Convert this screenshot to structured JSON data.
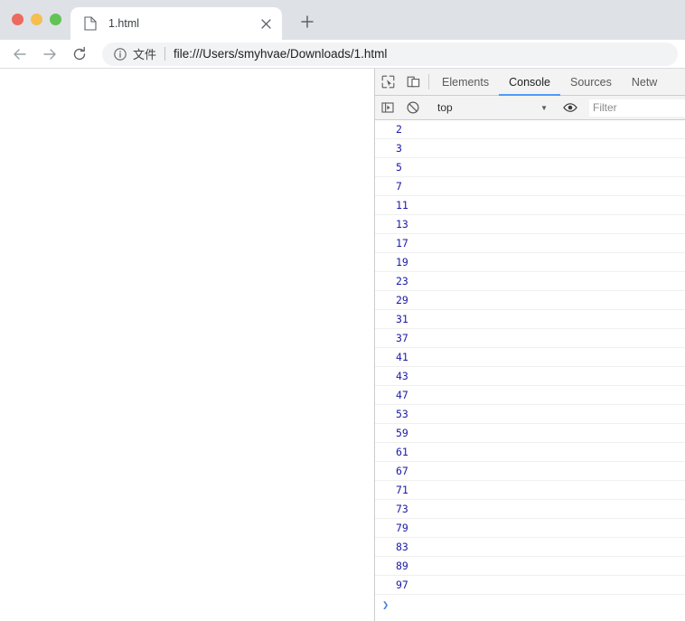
{
  "browser": {
    "window_controls": [
      {
        "name": "close",
        "color": "#ed6a5e"
      },
      {
        "name": "minimize",
        "color": "#f4bf4f"
      },
      {
        "name": "maximize",
        "color": "#61c454"
      }
    ],
    "tab": {
      "title": "1.html",
      "favicon": "document-icon",
      "close_label": "×"
    },
    "new_tab_label": "+",
    "nav": {
      "back_label": "←",
      "forward_label": "→",
      "reload_label": "↻"
    },
    "omnibox": {
      "info_icon": "info-circle-icon",
      "scheme_label": "文件",
      "url": "file:///Users/smyhvae/Downloads/1.html"
    }
  },
  "devtools": {
    "inspect_icon": "inspect-element-icon",
    "device_icon": "device-toolbar-icon",
    "tabs": [
      {
        "label": "Elements",
        "active": false
      },
      {
        "label": "Console",
        "active": true
      },
      {
        "label": "Sources",
        "active": false
      },
      {
        "label": "Netw",
        "active": false
      }
    ],
    "console_toolbar": {
      "sidebar_icon": "console-sidebar-icon",
      "clear_icon": "clear-console-icon",
      "context": "top",
      "context_caret": "▼",
      "eye_icon": "live-expression-eye-icon",
      "filter_placeholder": "Filter"
    },
    "console_log_values": [
      2,
      3,
      5,
      7,
      11,
      13,
      17,
      19,
      23,
      29,
      31,
      37,
      41,
      43,
      47,
      53,
      59,
      61,
      67,
      71,
      73,
      79,
      83,
      89,
      97
    ],
    "prompt_caret": "❯",
    "colors": {
      "number": "#1a1aa6",
      "active_tab_underline": "#4e9bf5",
      "prompt": "#4a7bde"
    }
  }
}
